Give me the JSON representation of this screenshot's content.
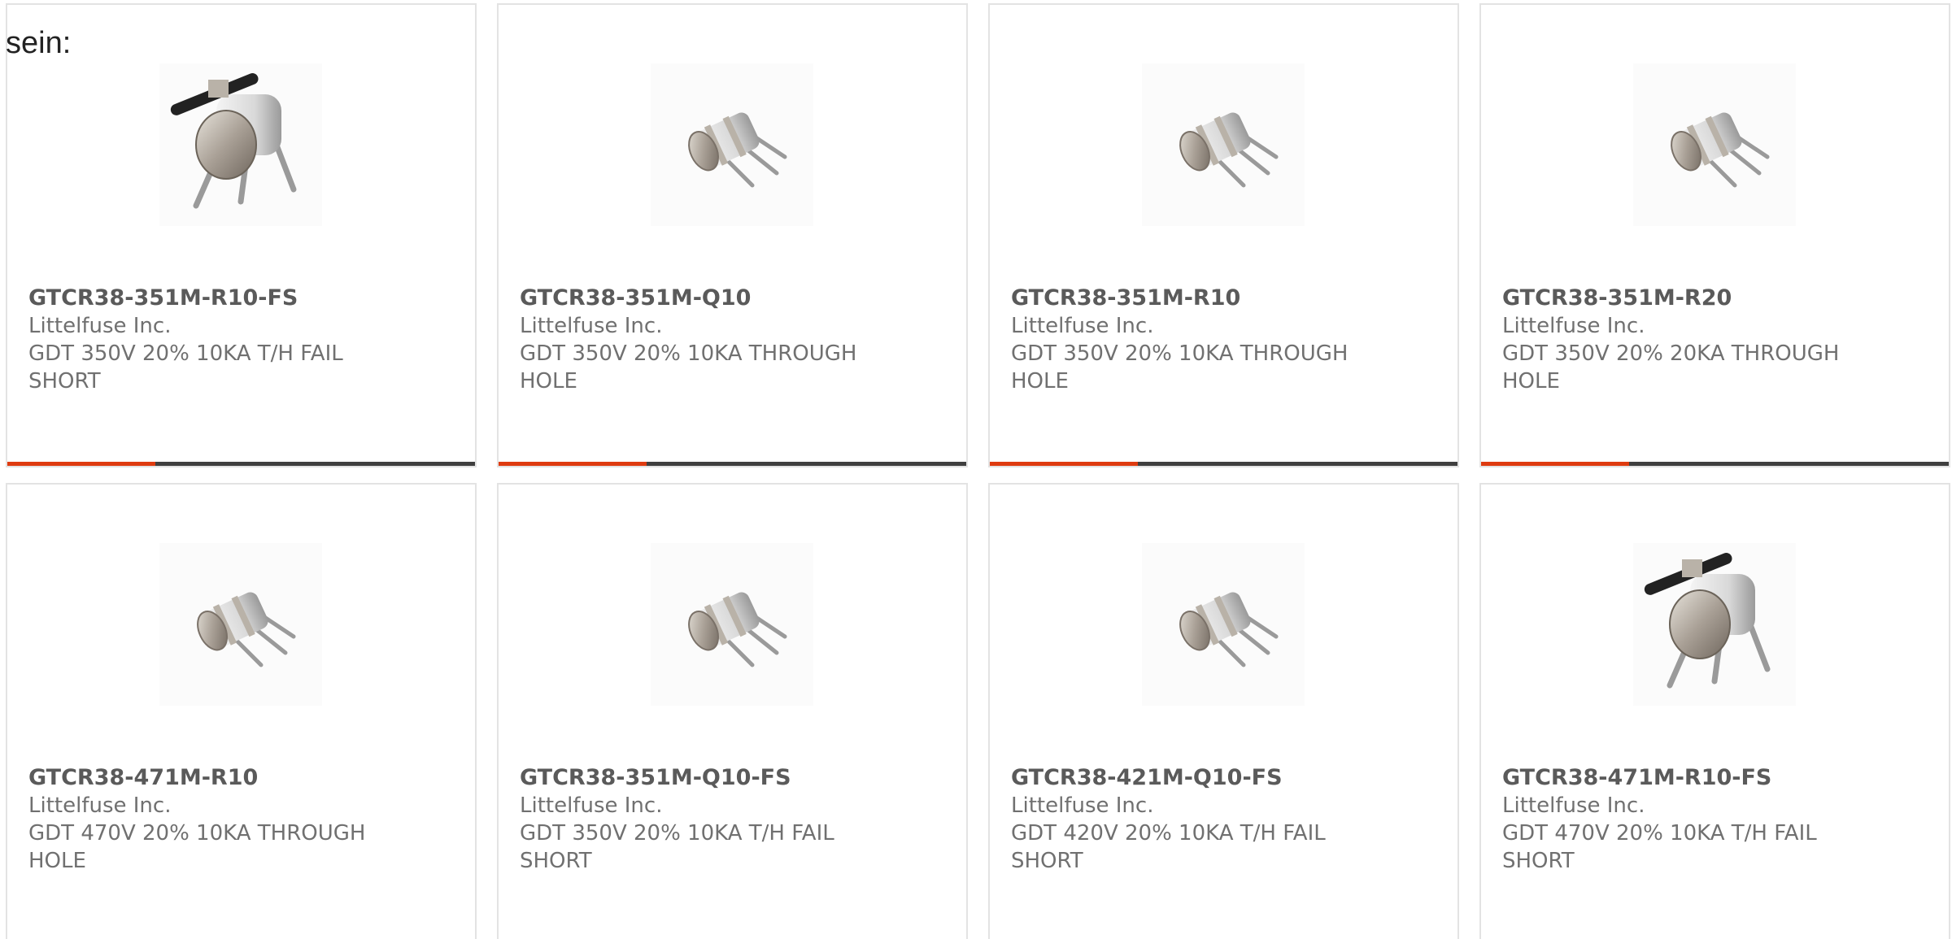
{
  "intro_text": "sein:",
  "colors": {
    "accent": "#de3b10",
    "bar": "#3f3f3f",
    "border": "#e3e3e3",
    "text": "#707070"
  },
  "products": [
    {
      "part": "GTCR38-351M-R10-FS",
      "maker": "Littelfuse Inc.",
      "desc_1": "GDT 350V 20% 10KA T/H FAIL",
      "desc_2": "SHORT",
      "image": "gdt-fail-short-image"
    },
    {
      "part": "GTCR38-351M-Q10",
      "maker": "Littelfuse Inc.",
      "desc_1": "GDT 350V 20% 10KA THROUGH",
      "desc_2": "HOLE",
      "image": "gdt-image"
    },
    {
      "part": "GTCR38-351M-R10",
      "maker": "Littelfuse Inc.",
      "desc_1": "GDT 350V 20% 10KA THROUGH",
      "desc_2": "HOLE",
      "image": "gdt-image"
    },
    {
      "part": "GTCR38-351M-R20",
      "maker": "Littelfuse Inc.",
      "desc_1": "GDT 350V 20% 20KA THROUGH",
      "desc_2": "HOLE",
      "image": "gdt-image"
    },
    {
      "part": "GTCR38-471M-R10",
      "maker": "Littelfuse Inc.",
      "desc_1": "GDT 470V 20% 10KA THROUGH",
      "desc_2": "HOLE",
      "image": "gdt-image"
    },
    {
      "part": "GTCR38-351M-Q10-FS",
      "maker": "Littelfuse Inc.",
      "desc_1": "GDT 350V 20% 10KA T/H FAIL",
      "desc_2": "SHORT",
      "image": "gdt-image"
    },
    {
      "part": "GTCR38-421M-Q10-FS",
      "maker": "Littelfuse Inc.",
      "desc_1": "GDT 420V 20% 10KA T/H FAIL",
      "desc_2": "SHORT",
      "image": "gdt-image"
    },
    {
      "part": "GTCR38-471M-R10-FS",
      "maker": "Littelfuse Inc.",
      "desc_1": "GDT 470V 20% 10KA T/H FAIL",
      "desc_2": "SHORT",
      "image": "gdt-fail-short-image"
    }
  ]
}
